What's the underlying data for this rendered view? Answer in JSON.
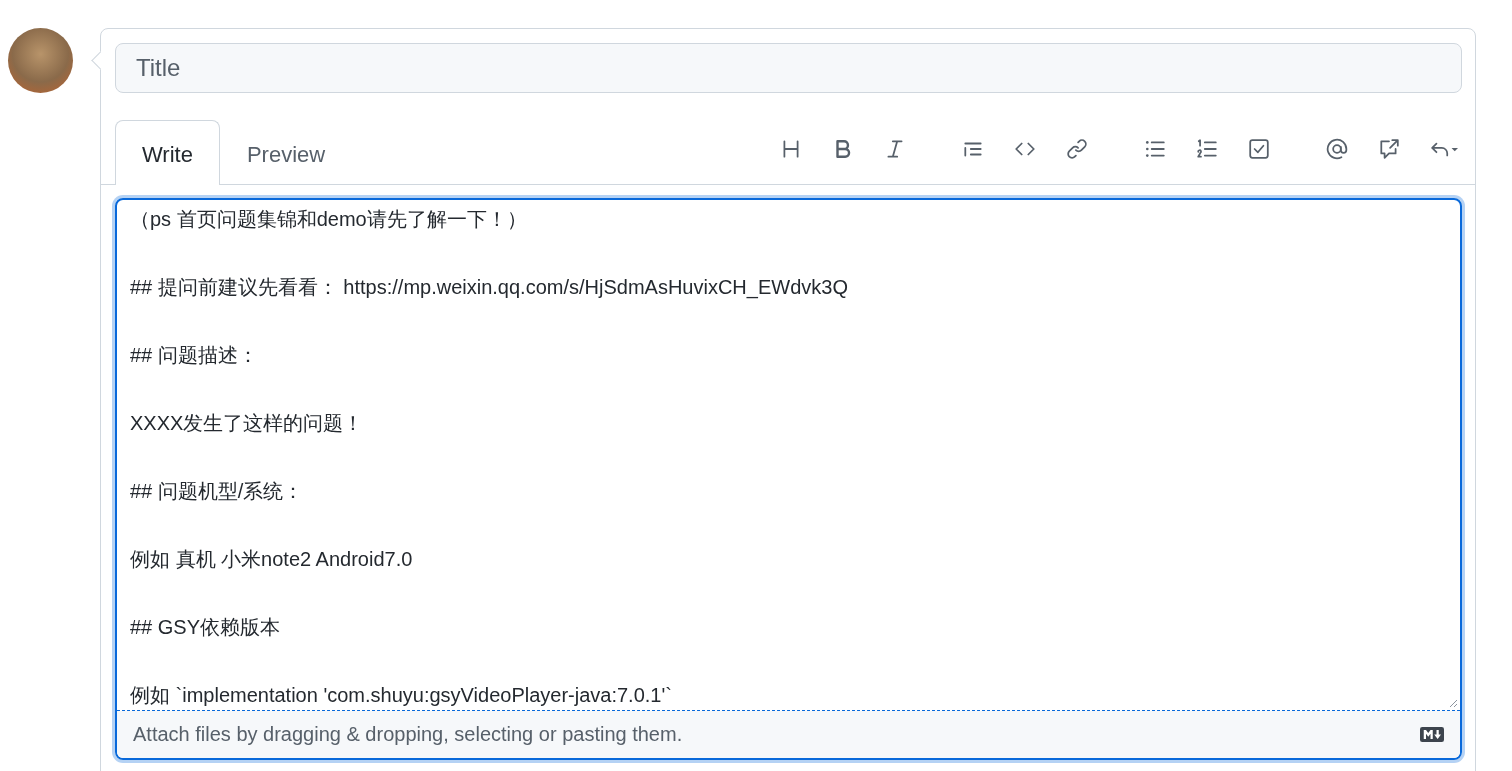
{
  "title_field": {
    "placeholder": "Title"
  },
  "tabs": [
    {
      "label": "Write",
      "selected": true
    },
    {
      "label": "Preview",
      "selected": false
    }
  ],
  "toolbar": [
    {
      "items": [
        {
          "kind": "heading"
        },
        {
          "kind": "bold"
        },
        {
          "kind": "italic"
        }
      ]
    },
    {
      "items": [
        {
          "kind": "quote"
        },
        {
          "kind": "code"
        },
        {
          "kind": "link"
        }
      ]
    },
    {
      "items": [
        {
          "kind": "bullet-list"
        },
        {
          "kind": "numbered-list"
        },
        {
          "kind": "task-list"
        }
      ]
    },
    {
      "items": [
        {
          "kind": "mention"
        },
        {
          "kind": "reference"
        },
        {
          "kind": "reply"
        }
      ]
    }
  ],
  "body_field": {
    "lines": [
      "（ps 首页问题集锦和demo请先了解一下！）",
      "## 提问前建议先看看： https://mp.weixin.qq.com/s/HjSdmAsHuvixCH_EWdvk3Q",
      "## 问题描述：",
      "XXXX发生了这样的问题！",
      "## 问题机型/系统：",
      "例如 真机 小米note2 Android7.0",
      "## GSY依赖版本",
      "例如 `implementation 'com.shuyu:gsyVideoPlayer-java:7.0.1'`"
    ]
  },
  "attach_bar": {
    "text": "Attach files by dragging & dropping, selecting or pasting them."
  }
}
